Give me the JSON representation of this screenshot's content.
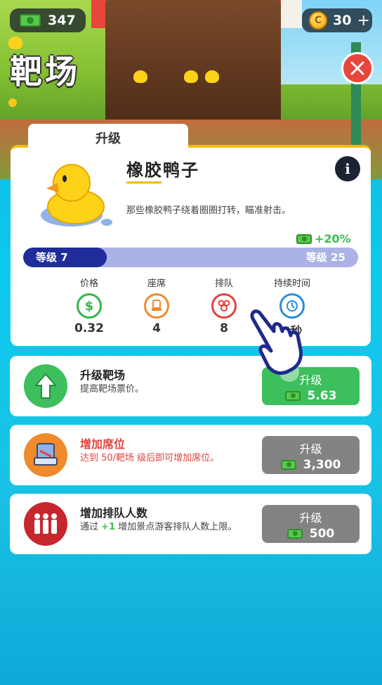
{
  "hud": {
    "cash": "347",
    "coins": "30",
    "coins_plus": "+"
  },
  "page": {
    "title": "靶场",
    "close_icon": "close-x"
  },
  "upgrade_panel": {
    "tab_label": "升级",
    "item_name": "橡胶鸭子",
    "item_desc": "那些橡胶鸭子绕着圈圈打转，瞄准射击。",
    "boost": "+20%",
    "level_current": "等级 7",
    "level_target": "等级 25",
    "level_progress_fraction": 0.25,
    "stats": [
      {
        "label": "价格",
        "value": "0.32",
        "icon": "dollar-icon",
        "color": "#33b54a"
      },
      {
        "label": "座席",
        "value": "4",
        "icon": "seat-icon",
        "color": "#f08a2a"
      },
      {
        "label": "排队",
        "value": "8",
        "icon": "queue-icon",
        "color": "#e0433c"
      },
      {
        "label": "持续时间",
        "value": "5秒",
        "icon": "clock-icon",
        "color": "#2a8ce0"
      }
    ]
  },
  "upgrades": [
    {
      "title": "升级靶场",
      "desc": "提高靶场票价。",
      "button_label": "升级",
      "cost": "5.63",
      "enabled": true,
      "color": "#3cbf5c"
    },
    {
      "title": "增加席位",
      "desc": "达到 50/靶场 级后即可增加席位。",
      "button_label": "升级",
      "cost": "3,300",
      "enabled": false,
      "color": "#f08a2a"
    },
    {
      "title": "增加排队人数",
      "desc_prefix": "通过 ",
      "desc_bonus": "+1",
      "desc_suffix": " 增加景点游客排队人数上限。",
      "button_label": "升级",
      "cost": "500",
      "enabled": false,
      "color": "#e0433c"
    }
  ],
  "colors": {
    "accent_yellow": "#f6b916",
    "button_green": "#3cbf5c",
    "button_gray": "#838383",
    "progress_fill": "#1f2c9a",
    "progress_track": "#aab2e6"
  }
}
